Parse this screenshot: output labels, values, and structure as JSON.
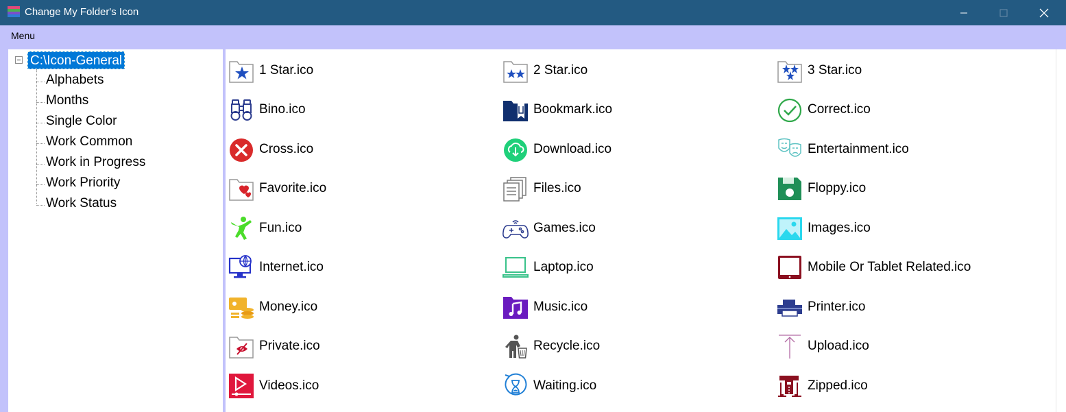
{
  "window": {
    "title": "Change My Folder's Icon"
  },
  "menu": {
    "label": "Menu"
  },
  "tree": {
    "root": "C:\\Icon-General",
    "children": [
      "Alphabets",
      "Months",
      "Single Color",
      "Work Common",
      "Work in Progress",
      "Work Priority",
      "Work Status"
    ]
  },
  "icons": [
    {
      "label": "1 Star.ico",
      "icon": "one-star-folder-icon"
    },
    {
      "label": "2 Star.ico",
      "icon": "two-star-folder-icon"
    },
    {
      "label": "3 Star.ico",
      "icon": "three-star-folder-icon"
    },
    {
      "label": "Bino.ico",
      "icon": "binoculars-icon"
    },
    {
      "label": "Bookmark.ico",
      "icon": "bookmark-folder-icon"
    },
    {
      "label": "Correct.ico",
      "icon": "check-circle-icon"
    },
    {
      "label": "Cross.ico",
      "icon": "cross-circle-icon"
    },
    {
      "label": "Download.ico",
      "icon": "download-cloud-icon"
    },
    {
      "label": "Entertainment.ico",
      "icon": "theater-masks-icon"
    },
    {
      "label": "Favorite.ico",
      "icon": "heart-folder-icon"
    },
    {
      "label": "Files.ico",
      "icon": "files-icon"
    },
    {
      "label": "Floppy.ico",
      "icon": "floppy-disk-icon"
    },
    {
      "label": "Fun.ico",
      "icon": "dancing-person-icon"
    },
    {
      "label": "Games.ico",
      "icon": "gamepad-icon"
    },
    {
      "label": "Images.ico",
      "icon": "image-icon"
    },
    {
      "label": "Internet.ico",
      "icon": "globe-monitor-icon"
    },
    {
      "label": "Laptop.ico",
      "icon": "laptop-icon"
    },
    {
      "label": "Mobile Or Tablet Related.ico",
      "icon": "tablet-icon"
    },
    {
      "label": "Money.ico",
      "icon": "money-icon"
    },
    {
      "label": "Music.ico",
      "icon": "music-folder-icon"
    },
    {
      "label": "Printer.ico",
      "icon": "printer-icon"
    },
    {
      "label": "Private.ico",
      "icon": "hidden-eye-folder-icon"
    },
    {
      "label": "Recycle.ico",
      "icon": "recycle-bin-icon"
    },
    {
      "label": "Upload.ico",
      "icon": "upload-arrow-icon"
    },
    {
      "label": "Videos.ico",
      "icon": "video-play-icon"
    },
    {
      "label": "Waiting.ico",
      "icon": "hourglass-icon"
    },
    {
      "label": "Zipped.ico",
      "icon": "zip-archive-icon"
    }
  ],
  "colors": {
    "titlebar": "#235a82",
    "menubar": "#c2c2fb",
    "selection": "#0078d7"
  }
}
